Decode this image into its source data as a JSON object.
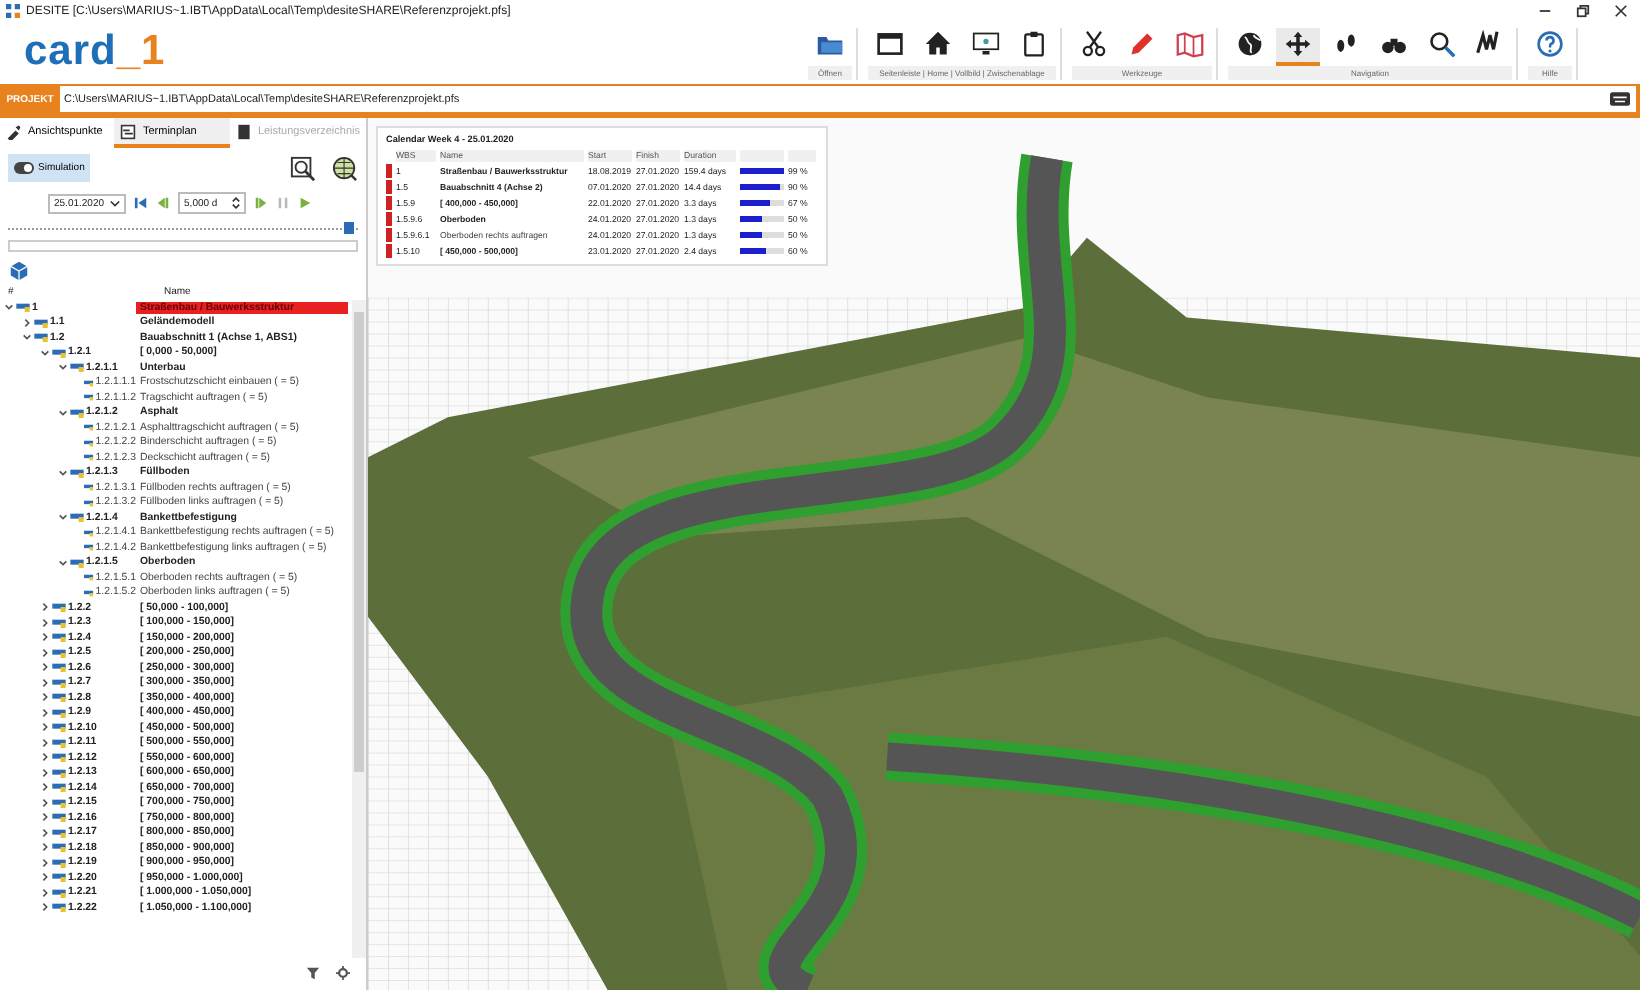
{
  "window": {
    "title": "DESITE [C:\\Users\\MARIUS~1.IBT\\AppData\\Local\\Temp\\desiteSHARE\\Referenzprojekt.pfs]"
  },
  "logo": {
    "text": "card",
    "accent": "_1"
  },
  "ribbon": {
    "groups": [
      {
        "label": "Öffnen",
        "tools": [
          {
            "selected": false
          }
        ]
      },
      {
        "label": "Seitenleiste | Home | Vollbild | Zwischenablage",
        "tools": [
          {
            "selected": false
          },
          {
            "selected": false
          },
          {
            "selected": false
          },
          {
            "selected": false
          }
        ]
      },
      {
        "label": "Werkzeuge",
        "tools": [
          {
            "selected": false
          },
          {
            "selected": false
          },
          {
            "selected": false
          }
        ]
      },
      {
        "label": "Navigation",
        "tools": [
          {
            "selected": false
          },
          {
            "selected": true
          },
          {
            "selected": false
          },
          {
            "selected": false
          },
          {
            "selected": false
          },
          {
            "selected": false
          }
        ]
      },
      {
        "label": "Hilfe",
        "tools": [
          {
            "selected": false
          }
        ]
      }
    ]
  },
  "project_bar": {
    "label": "PROJEKT",
    "path": "C:\\Users\\MARIUS~1.IBT\\AppData\\Local\\Temp\\desiteSHARE\\Referenzprojekt.pfs"
  },
  "tabs": [
    {
      "label": "Ansichtspunkte",
      "selected": false,
      "disabled": false
    },
    {
      "label": "Terminplan",
      "selected": true,
      "disabled": false
    },
    {
      "label": "Leistungsverzeichnis",
      "selected": false,
      "disabled": true
    }
  ],
  "simulation": {
    "label": "Simulation",
    "on": true
  },
  "date_picker": {
    "value": "25.01.2020"
  },
  "step_field": {
    "value": "5,000 d"
  },
  "timeline": {
    "level": 0.98
  },
  "tree": {
    "columns": [
      "#",
      "Name"
    ],
    "nodes": [
      {
        "number": "1",
        "name": "Straßenbau / Bauwerksstruktur",
        "kind": "group",
        "selected": true,
        "expanded": true,
        "children": [
          {
            "number": "1.1",
            "name": "Geländemodell",
            "kind": "group",
            "selected": false,
            "expanded": false
          },
          {
            "number": "1.2",
            "name": "Bauabschnitt 1 (Achse 1, ABS1)",
            "kind": "group",
            "selected": false,
            "expanded": true,
            "children": [
              {
                "number": "1.2.1",
                "name": "[ 0,000 - 50,000]",
                "kind": "group",
                "selected": false,
                "expanded": true,
                "children": [
                  {
                    "number": "1.2.1.1",
                    "name": "Unterbau",
                    "kind": "group",
                    "selected": false,
                    "expanded": true,
                    "children": [
                      {
                        "number": "1.2.1.1.1",
                        "name": "Frostschutzschicht einbauen ( = 5)",
                        "kind": "task",
                        "selected": false
                      },
                      {
                        "number": "1.2.1.1.2",
                        "name": "Tragschicht auftragen ( = 5)",
                        "kind": "task",
                        "selected": false
                      }
                    ]
                  },
                  {
                    "number": "1.2.1.2",
                    "name": "Asphalt",
                    "kind": "group",
                    "selected": false,
                    "expanded": true,
                    "children": [
                      {
                        "number": "1.2.1.2.1",
                        "name": "Asphalttragschicht auftragen ( = 5)",
                        "kind": "task",
                        "selected": false
                      },
                      {
                        "number": "1.2.1.2.2",
                        "name": "Binderschicht auftragen ( = 5)",
                        "kind": "task",
                        "selected": false
                      },
                      {
                        "number": "1.2.1.2.3",
                        "name": "Deckschicht auftragen ( = 5)",
                        "kind": "task",
                        "selected": false
                      }
                    ]
                  },
                  {
                    "number": "1.2.1.3",
                    "name": "Füllboden",
                    "kind": "group",
                    "selected": false,
                    "expanded": true,
                    "children": [
                      {
                        "number": "1.2.1.3.1",
                        "name": "Füllboden rechts auftragen ( = 5)",
                        "kind": "task",
                        "selected": false
                      },
                      {
                        "number": "1.2.1.3.2",
                        "name": "Füllboden links auftragen ( = 5)",
                        "kind": "task",
                        "selected": false
                      }
                    ]
                  },
                  {
                    "number": "1.2.1.4",
                    "name": "Bankettbefestigung",
                    "kind": "group",
                    "selected": false,
                    "expanded": true,
                    "children": [
                      {
                        "number": "1.2.1.4.1",
                        "name": "Bankettbefestigung rechts auftragen ( = 5)",
                        "kind": "task",
                        "selected": false
                      },
                      {
                        "number": "1.2.1.4.2",
                        "name": "Bankettbefestigung links auftragen ( = 5)",
                        "kind": "task",
                        "selected": false
                      }
                    ]
                  },
                  {
                    "number": "1.2.1.5",
                    "name": "Oberboden",
                    "kind": "group",
                    "selected": false,
                    "expanded": true,
                    "children": [
                      {
                        "number": "1.2.1.5.1",
                        "name": "Oberboden rechts auftragen ( = 5)",
                        "kind": "task",
                        "selected": false
                      },
                      {
                        "number": "1.2.1.5.2",
                        "name": "Oberboden links auftragen ( = 5)",
                        "kind": "task",
                        "selected": false
                      }
                    ]
                  }
                ]
              },
              {
                "number": "1.2.2",
                "name": "[ 50,000 - 100,000]",
                "kind": "group",
                "selected": false,
                "expanded": false
              },
              {
                "number": "1.2.3",
                "name": "[ 100,000 - 150,000]",
                "kind": "group",
                "selected": false,
                "expanded": false
              },
              {
                "number": "1.2.4",
                "name": "[ 150,000 - 200,000]",
                "kind": "group",
                "selected": false,
                "expanded": false
              },
              {
                "number": "1.2.5",
                "name": "[ 200,000 - 250,000]",
                "kind": "group",
                "selected": false,
                "expanded": false
              },
              {
                "number": "1.2.6",
                "name": "[ 250,000 - 300,000]",
                "kind": "group",
                "selected": false,
                "expanded": false
              },
              {
                "number": "1.2.7",
                "name": "[ 300,000 - 350,000]",
                "kind": "group",
                "selected": false,
                "expanded": false
              },
              {
                "number": "1.2.8",
                "name": "[ 350,000 - 400,000]",
                "kind": "group",
                "selected": false,
                "expanded": false
              },
              {
                "number": "1.2.9",
                "name": "[ 400,000 - 450,000]",
                "kind": "group",
                "selected": false,
                "expanded": false
              },
              {
                "number": "1.2.10",
                "name": "[ 450,000 - 500,000]",
                "kind": "group",
                "selected": false,
                "expanded": false
              },
              {
                "number": "1.2.11",
                "name": "[ 500,000 - 550,000]",
                "kind": "group",
                "selected": false,
                "expanded": false
              },
              {
                "number": "1.2.12",
                "name": "[ 550,000 - 600,000]",
                "kind": "group",
                "selected": false,
                "expanded": false
              },
              {
                "number": "1.2.13",
                "name": "[ 600,000 - 650,000]",
                "kind": "group",
                "selected": false,
                "expanded": false
              },
              {
                "number": "1.2.14",
                "name": "[ 650,000 - 700,000]",
                "kind": "group",
                "selected": false,
                "expanded": false
              },
              {
                "number": "1.2.15",
                "name": "[ 700,000 - 750,000]",
                "kind": "group",
                "selected": false,
                "expanded": false
              },
              {
                "number": "1.2.16",
                "name": "[ 750,000 - 800,000]",
                "kind": "group",
                "selected": false,
                "expanded": false
              },
              {
                "number": "1.2.17",
                "name": "[ 800,000 - 850,000]",
                "kind": "group",
                "selected": false,
                "expanded": false
              },
              {
                "number": "1.2.18",
                "name": "[ 850,000 - 900,000]",
                "kind": "group",
                "selected": false,
                "expanded": false
              },
              {
                "number": "1.2.19",
                "name": "[ 900,000 - 950,000]",
                "kind": "group",
                "selected": false,
                "expanded": false
              },
              {
                "number": "1.2.20",
                "name": "[ 950,000 - 1.000,000]",
                "kind": "group",
                "selected": false,
                "expanded": false
              },
              {
                "number": "1.2.21",
                "name": "[ 1.000,000 - 1.050,000]",
                "kind": "group",
                "selected": false,
                "expanded": false
              },
              {
                "number": "1.2.22",
                "name": "[ 1.050,000 - 1.100,000]",
                "kind": "group",
                "selected": false,
                "expanded": false
              }
            ]
          }
        ]
      }
    ]
  },
  "calendar": {
    "title": "Calendar Week 4 - 25.01.2020",
    "columns": [
      "WBS",
      "Name",
      "Start",
      "Finish",
      "Duration"
    ],
    "rows": [
      {
        "wbs": "1",
        "name": "Straßenbau / Bauwerksstruktur",
        "kind": "group",
        "start": "18.08.2019",
        "finish": "27.01.2020",
        "duration": "159.4 days",
        "level": 0.99,
        "percent": "99 %"
      },
      {
        "wbs": "1.5",
        "name": "Bauabschnitt 4 (Achse 2)",
        "kind": "group",
        "start": "07.01.2020",
        "finish": "27.01.2020",
        "duration": "14.4 days",
        "level": 0.9,
        "percent": "90 %"
      },
      {
        "wbs": "1.5.9",
        "name": "[ 400,000 - 450,000]",
        "kind": "group",
        "start": "22.01.2020",
        "finish": "27.01.2020",
        "duration": "3.3 days",
        "level": 0.67,
        "percent": "67 %"
      },
      {
        "wbs": "1.5.9.6",
        "name": "Oberboden",
        "kind": "group",
        "start": "24.01.2020",
        "finish": "27.01.2020",
        "duration": "1.3 days",
        "level": 0.5,
        "percent": "50 %"
      },
      {
        "wbs": "1.5.9.6.1",
        "name": "Oberboden rechts auftragen",
        "kind": "task",
        "start": "24.01.2020",
        "finish": "27.01.2020",
        "duration": "1.3 days",
        "level": 0.5,
        "percent": "50 %"
      },
      {
        "wbs": "1.5.10",
        "name": "[ 450,000 - 500,000]",
        "kind": "group",
        "start": "23.01.2020",
        "finish": "27.01.2020",
        "duration": "2.4 days",
        "level": 0.6,
        "percent": "60 %"
      }
    ]
  }
}
